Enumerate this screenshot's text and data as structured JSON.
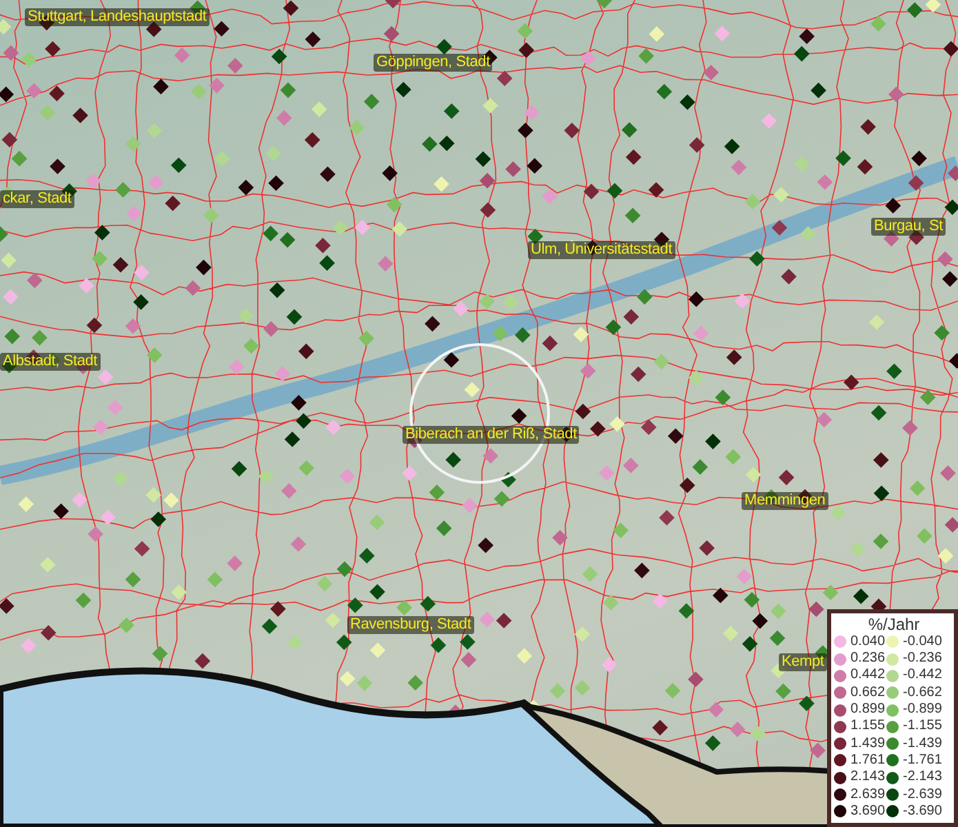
{
  "map": {
    "places": [
      {
        "name": "Stuttgart, Landeshauptstadt"
      },
      {
        "name": "Göppingen, Stadt"
      },
      {
        "name": "ckar, Stadt"
      },
      {
        "name": "Ulm, Universitätsstadt"
      },
      {
        "name": "Burgau, St"
      },
      {
        "name": "Albstadt, Stadt"
      },
      {
        "name": "Biberach an der Riß, Stadt"
      },
      {
        "name": "Memmingen"
      },
      {
        "name": "Ravensburg, Stadt"
      },
      {
        "name": "Kempt"
      }
    ]
  },
  "legend": {
    "title": "%/Jahr",
    "columns": [
      [
        {
          "label": "0.040",
          "color": "#f4b8e4"
        },
        {
          "label": "0.236",
          "color": "#e49ccc"
        },
        {
          "label": "0.442",
          "color": "#d07ca8"
        },
        {
          "label": "0.662",
          "color": "#c06890"
        },
        {
          "label": "0.899",
          "color": "#a84c70"
        },
        {
          "label": "1.155",
          "color": "#903850"
        },
        {
          "label": "1.439",
          "color": "#782838"
        },
        {
          "label": "1.761",
          "color": "#601820"
        },
        {
          "label": "2.143",
          "color": "#4a1018"
        },
        {
          "label": "2.639",
          "color": "#300810"
        },
        {
          "label": "3.690",
          "color": "#200408"
        }
      ],
      [
        {
          "label": "-0.040",
          "color": "#eef4b0"
        },
        {
          "label": "-0.236",
          "color": "#d0e8a0"
        },
        {
          "label": "-0.442",
          "color": "#b0d890"
        },
        {
          "label": "-0.662",
          "color": "#98cc78"
        },
        {
          "label": "-0.899",
          "color": "#80c060"
        },
        {
          "label": "-1.155",
          "color": "#58a040"
        },
        {
          "label": "-1.439",
          "color": "#3c8a30"
        },
        {
          "label": "-1.761",
          "color": "#207020"
        },
        {
          "label": "-2.143",
          "color": "#105a18"
        },
        {
          "label": "-2.639",
          "color": "#084810"
        },
        {
          "label": "-3.690",
          "color": "#043008"
        }
      ]
    ]
  }
}
